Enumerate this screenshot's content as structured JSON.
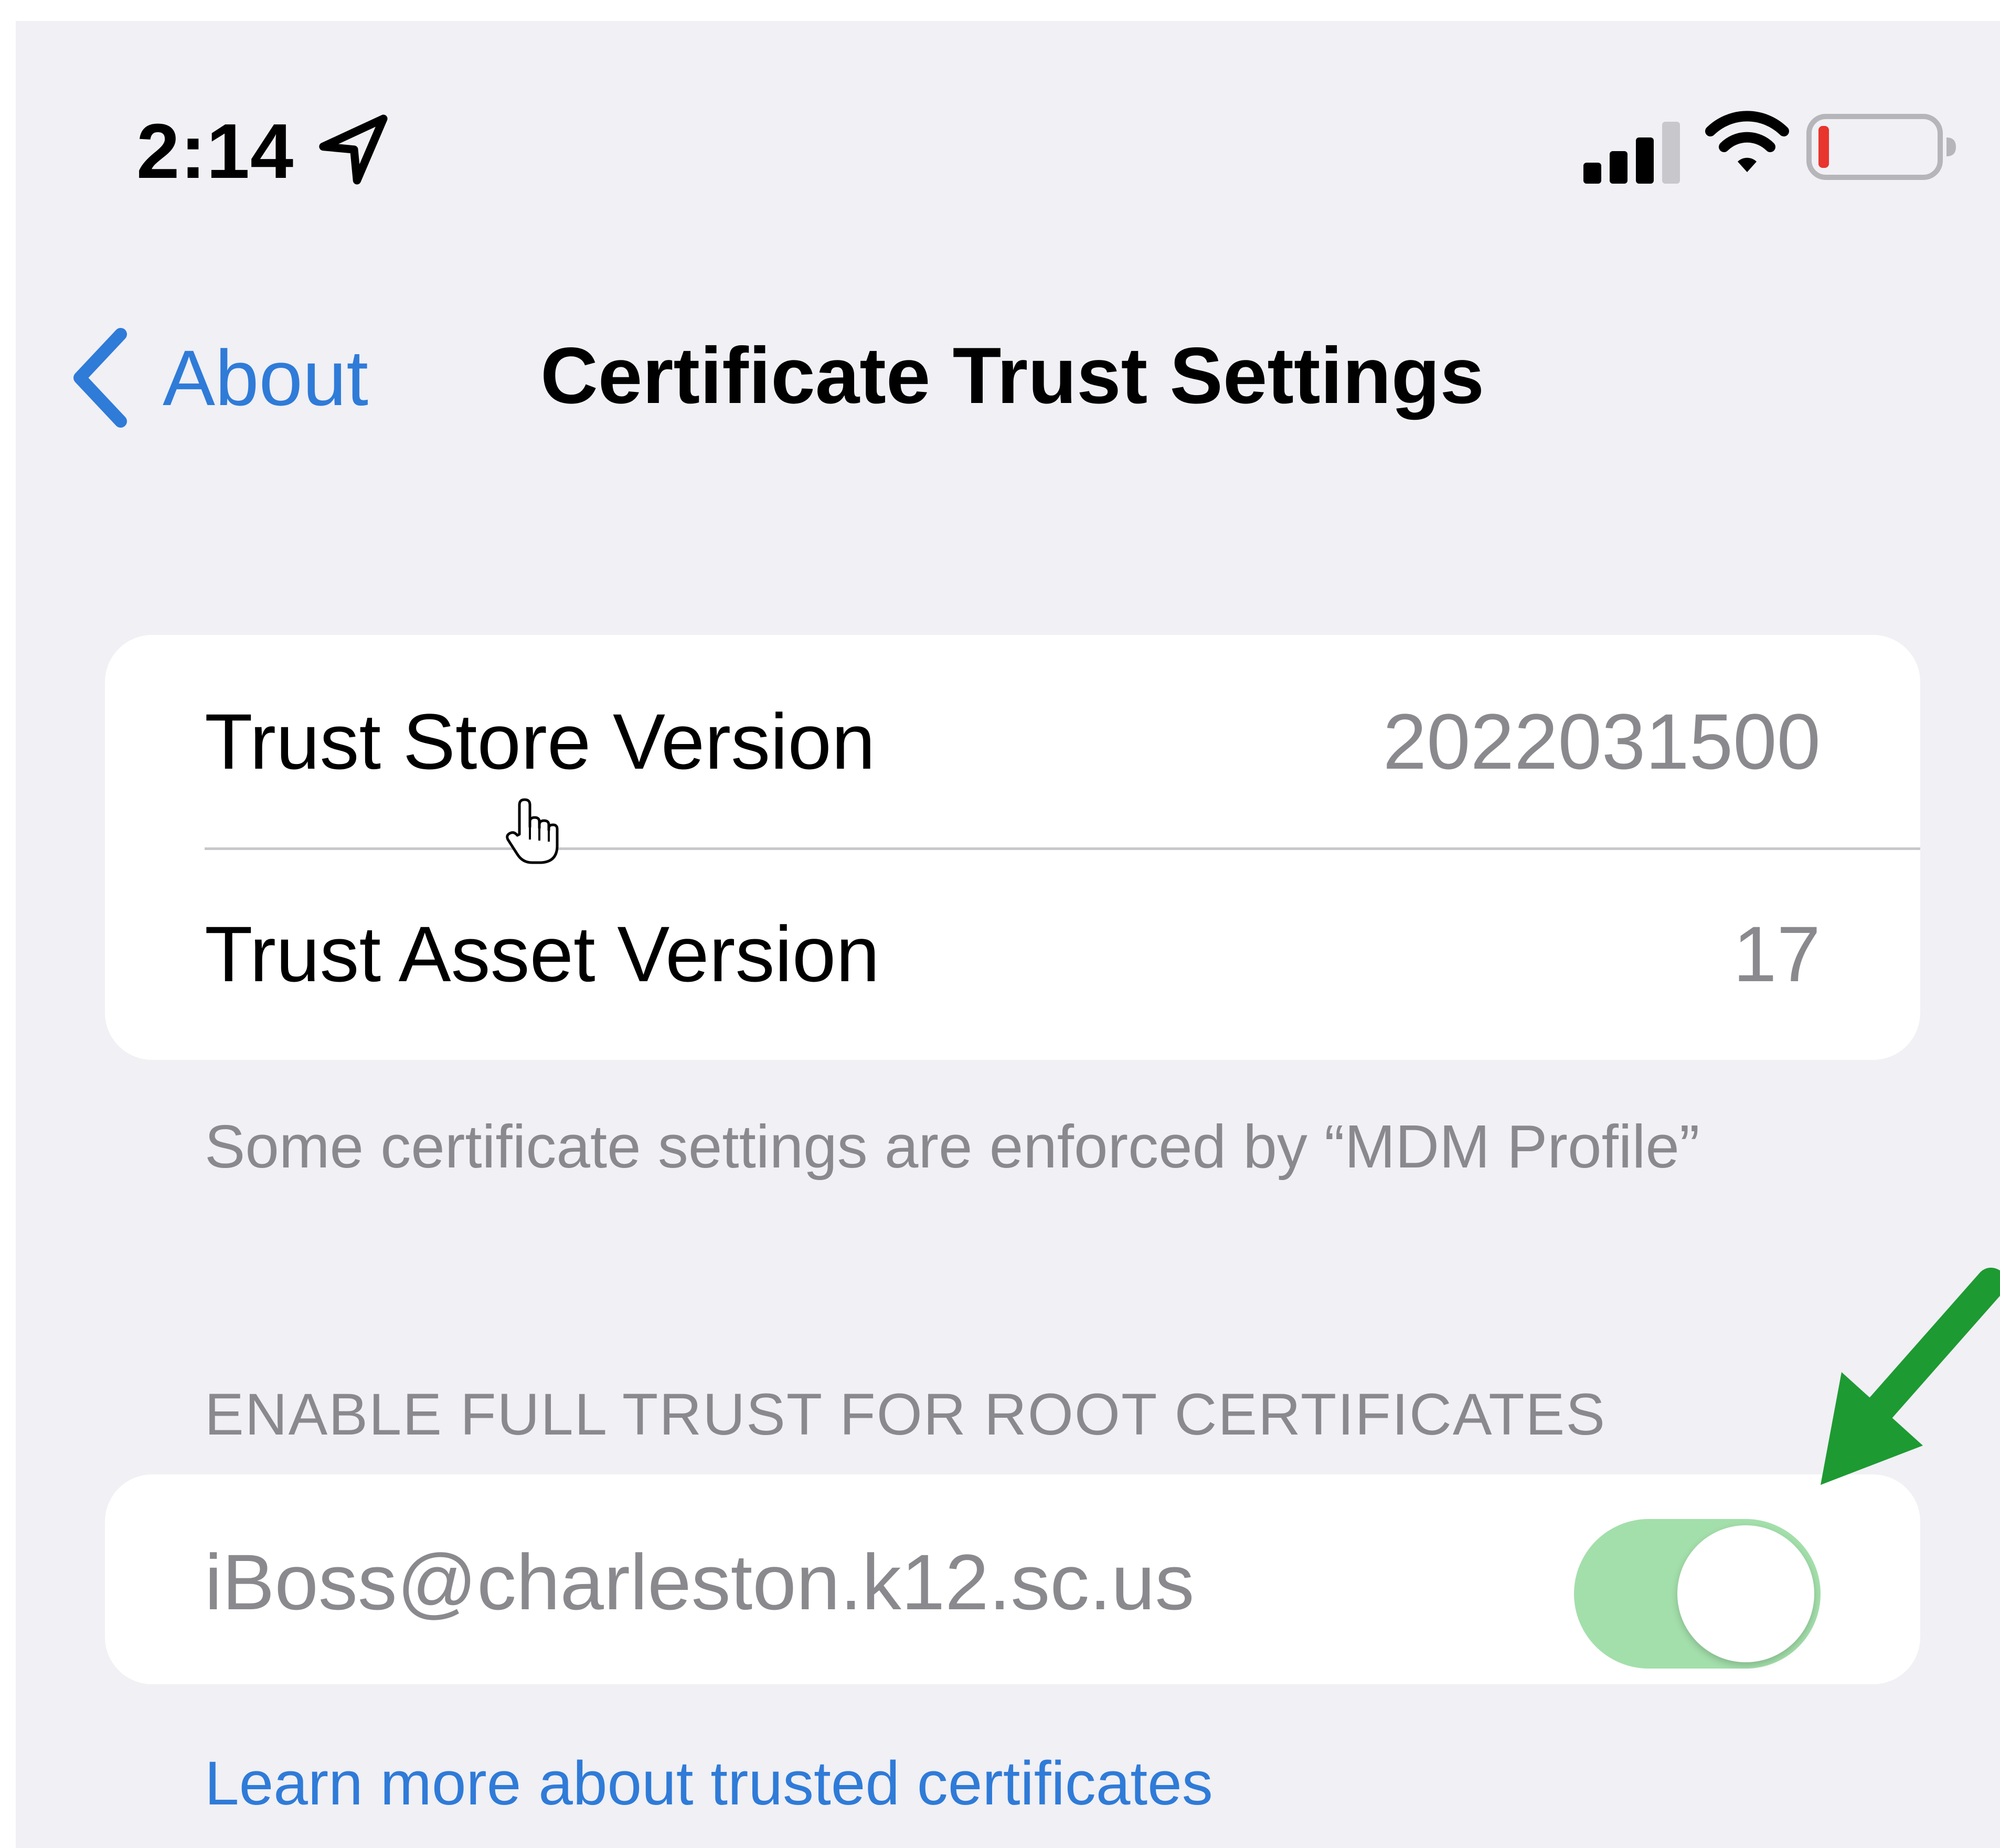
{
  "status_bar": {
    "time": "2:14",
    "icons": [
      "location-arrow-icon",
      "cellular-signal-icon",
      "wifi-icon",
      "battery-icon"
    ]
  },
  "nav": {
    "back_label": "About",
    "title": "Certificate Trust Settings"
  },
  "versions": [
    {
      "label": "Trust Store Version",
      "value": "2022031500"
    },
    {
      "label": "Trust Asset Version",
      "value": "17"
    }
  ],
  "footnote": "Some certificate settings are enforced by “MDM Profile”",
  "trust_section": {
    "header": "ENABLE FULL TRUST FOR ROOT CERTIFICATES",
    "certificate": "iBoss@charleston.k12.sc.us",
    "enabled": true
  },
  "learn_more": "Learn more about trusted certificates",
  "colors": {
    "background": "#f0f0f5",
    "accent_blue": "#2f7bd8",
    "toggle_on": "#a3dfab",
    "annotation_arrow": "#1e9a32",
    "secondary_text": "#8a8a8e"
  }
}
